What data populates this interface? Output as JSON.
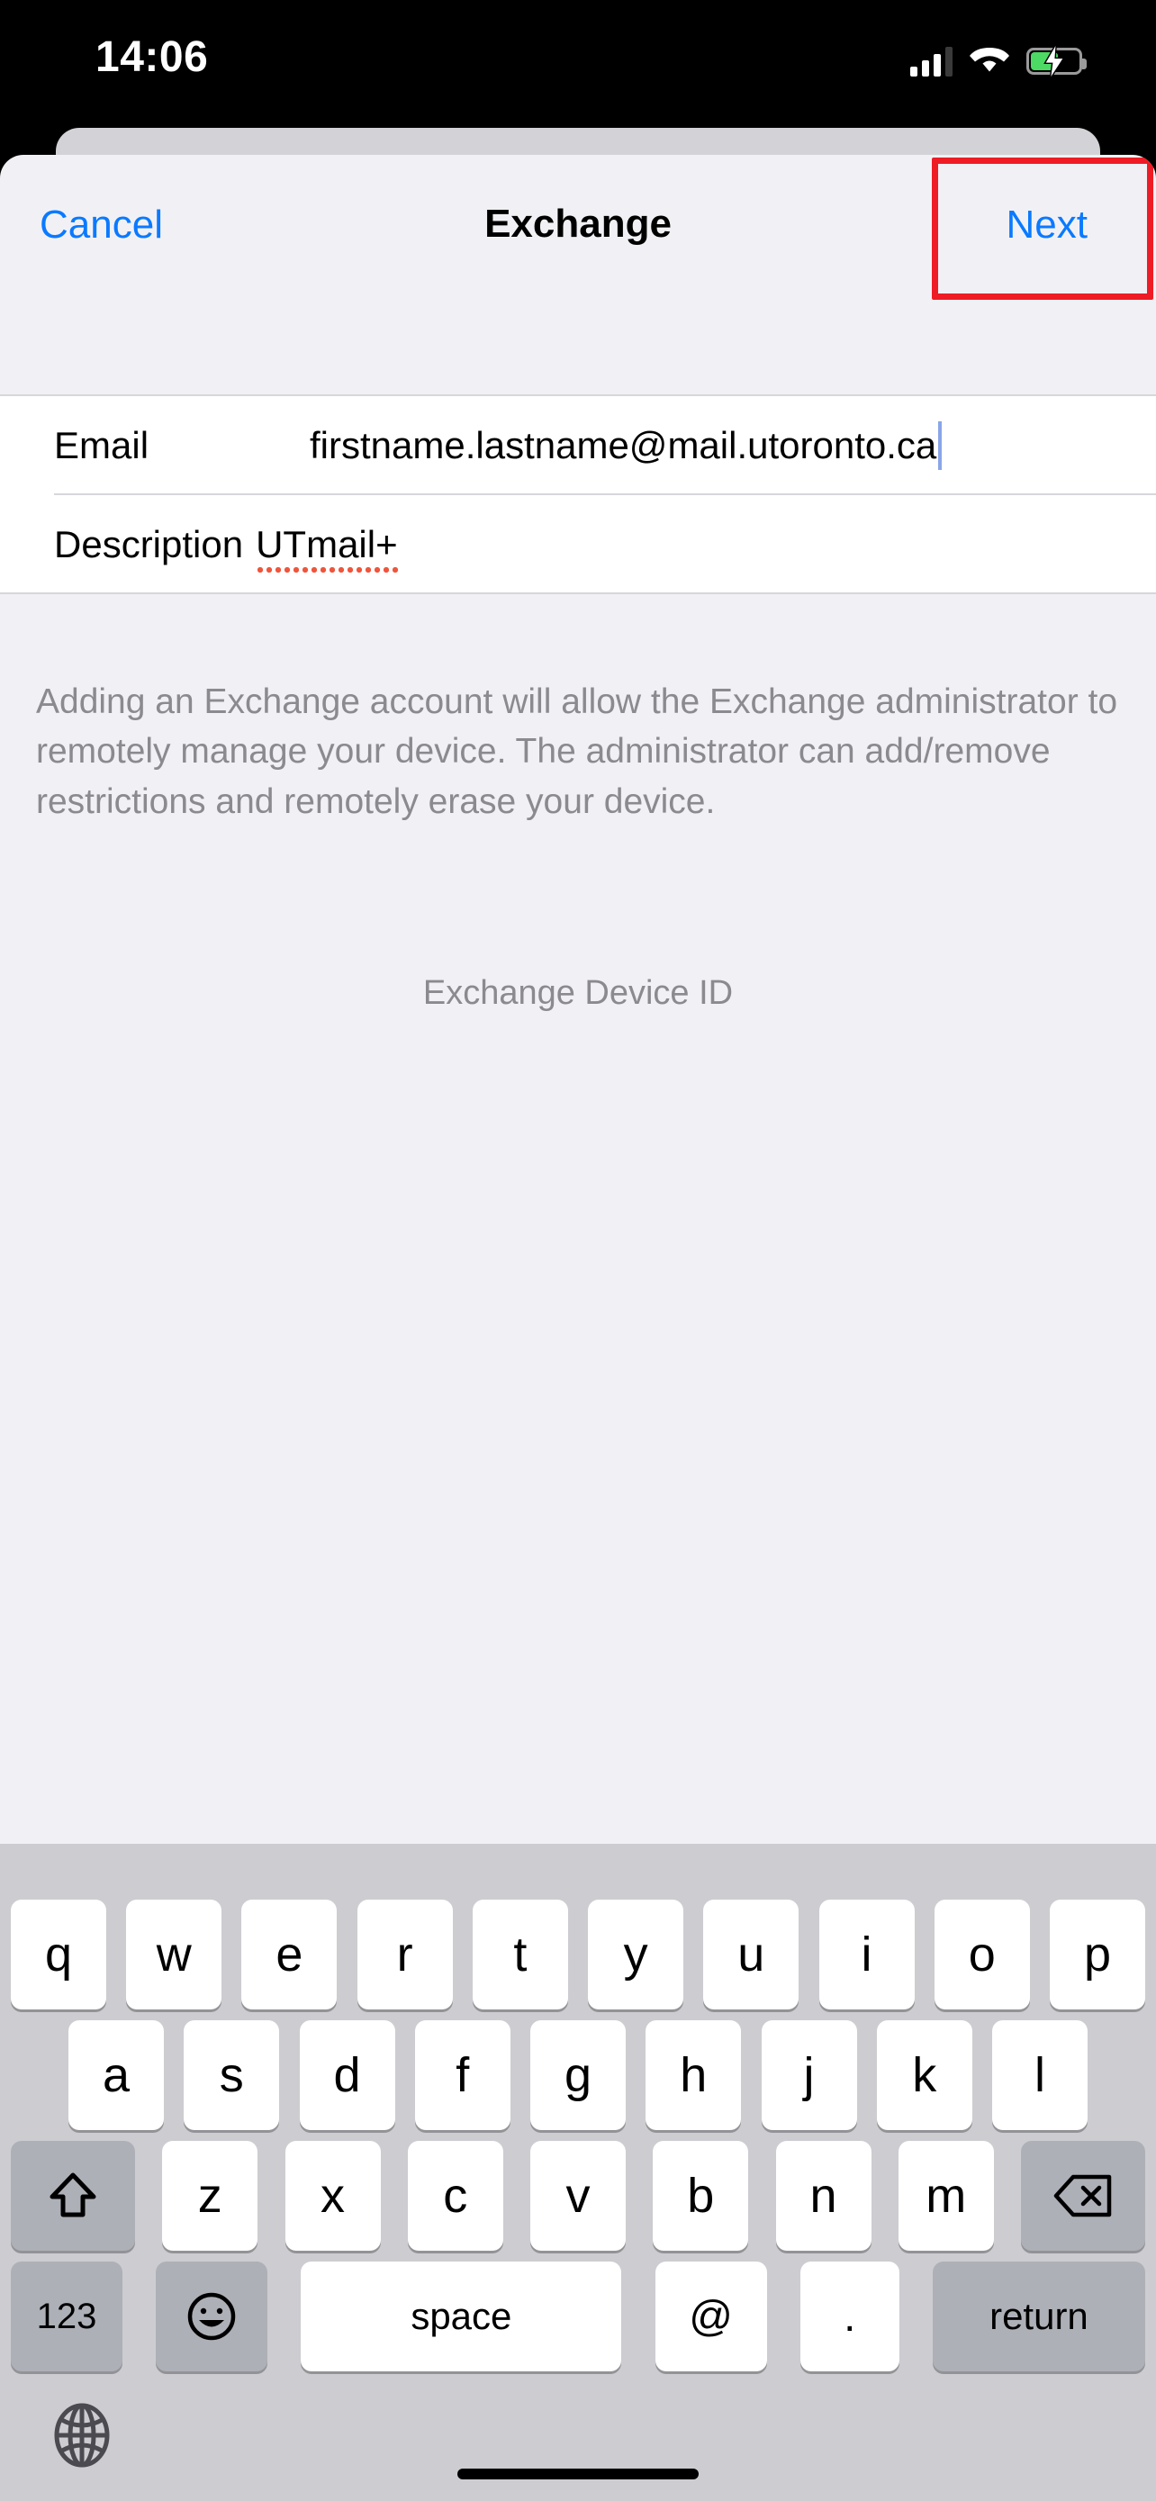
{
  "status_bar": {
    "time": "14:06",
    "signal_icon": "cellular-signal-icon",
    "wifi_icon": "wifi-icon",
    "battery_icon": "battery-charging-icon",
    "battery_color": "#4CD964"
  },
  "nav_bar": {
    "cancel_label": "Cancel",
    "title": "Exchange",
    "next_label": "Next",
    "accent_color": "#0a7aff",
    "highlight_color": "#ee1c25"
  },
  "form": {
    "rows": [
      {
        "label": "Email",
        "value": "firstname.lastname@mail.utoronto.ca"
      },
      {
        "label": "Description",
        "value": "UTmail+"
      }
    ]
  },
  "content": {
    "disclaimer": "Adding an Exchange account will allow the Exchange administrator to remotely manage your device. The administrator can add/remove restrictions and remotely erase your device.",
    "device_id_label": "Exchange Device ID"
  },
  "keyboard": {
    "row1": [
      "q",
      "w",
      "e",
      "r",
      "t",
      "y",
      "u",
      "i",
      "o",
      "p"
    ],
    "row2": [
      "a",
      "s",
      "d",
      "f",
      "g",
      "h",
      "j",
      "k",
      "l"
    ],
    "row3": [
      "z",
      "x",
      "c",
      "v",
      "b",
      "n",
      "m"
    ],
    "shift_icon": "shift-arrow-icon",
    "delete_icon": "backspace-delete-icon",
    "numbers_label": "123",
    "emoji_icon": "emoji-smiley-icon",
    "space_label": "space",
    "at_label": "@",
    "dot_label": ".",
    "return_label": "return",
    "globe_icon": "globe-language-icon"
  }
}
